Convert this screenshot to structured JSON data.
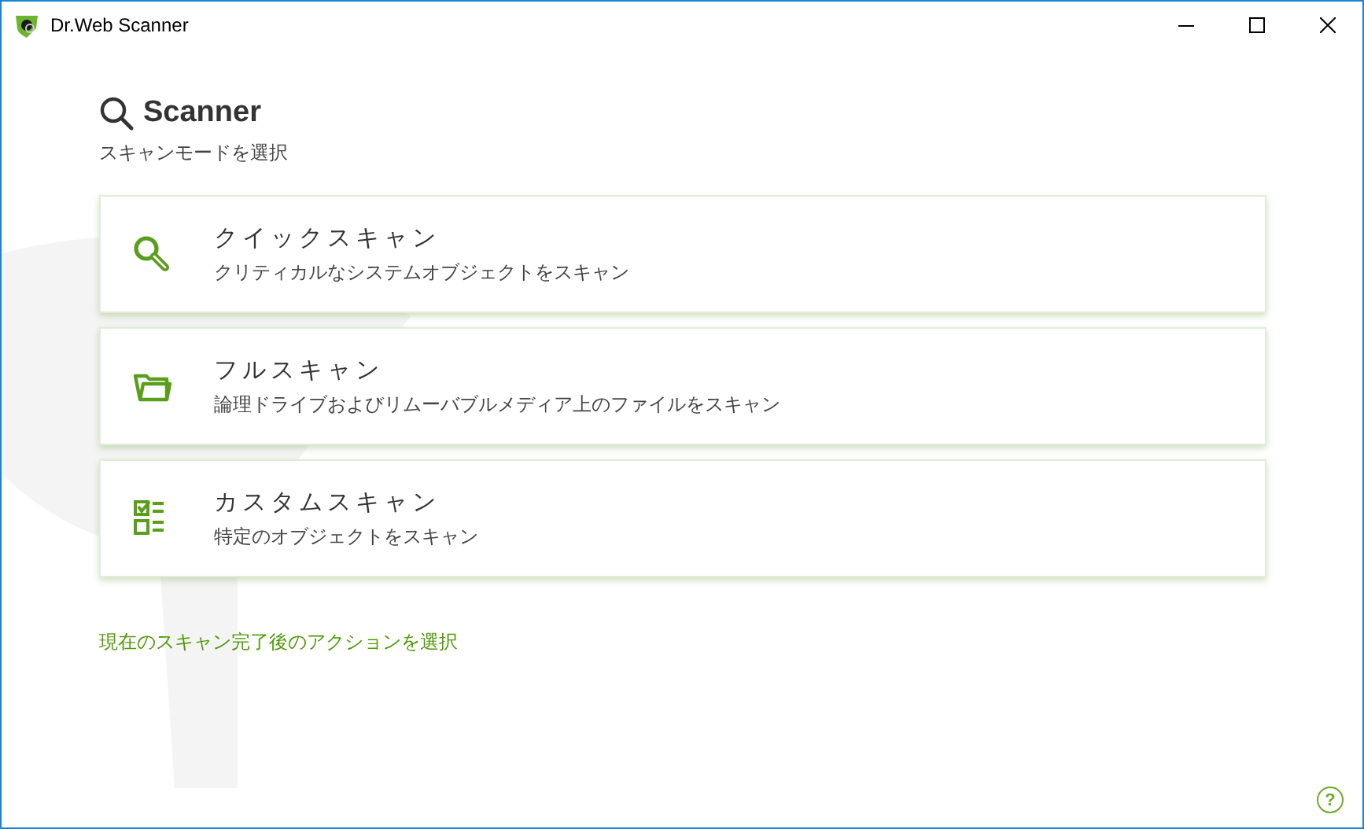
{
  "window": {
    "title": "Dr.Web Scanner"
  },
  "header": {
    "title": "Scanner",
    "subtitle": "スキャンモードを選択"
  },
  "scan_modes": [
    {
      "kind": "quick",
      "title": "クイックスキャン",
      "description": "クリティカルなシステムオブジェクトをスキャン"
    },
    {
      "kind": "full",
      "title": "フルスキャン",
      "description": "論理ドライブおよびリムーバブルメディア上のファイルをスキャン"
    },
    {
      "kind": "custom",
      "title": "カスタムスキャン",
      "description": "特定のオブジェクトをスキャン"
    }
  ],
  "action_link": "現在のスキャン完了後のアクションを選択",
  "help_button": "?"
}
